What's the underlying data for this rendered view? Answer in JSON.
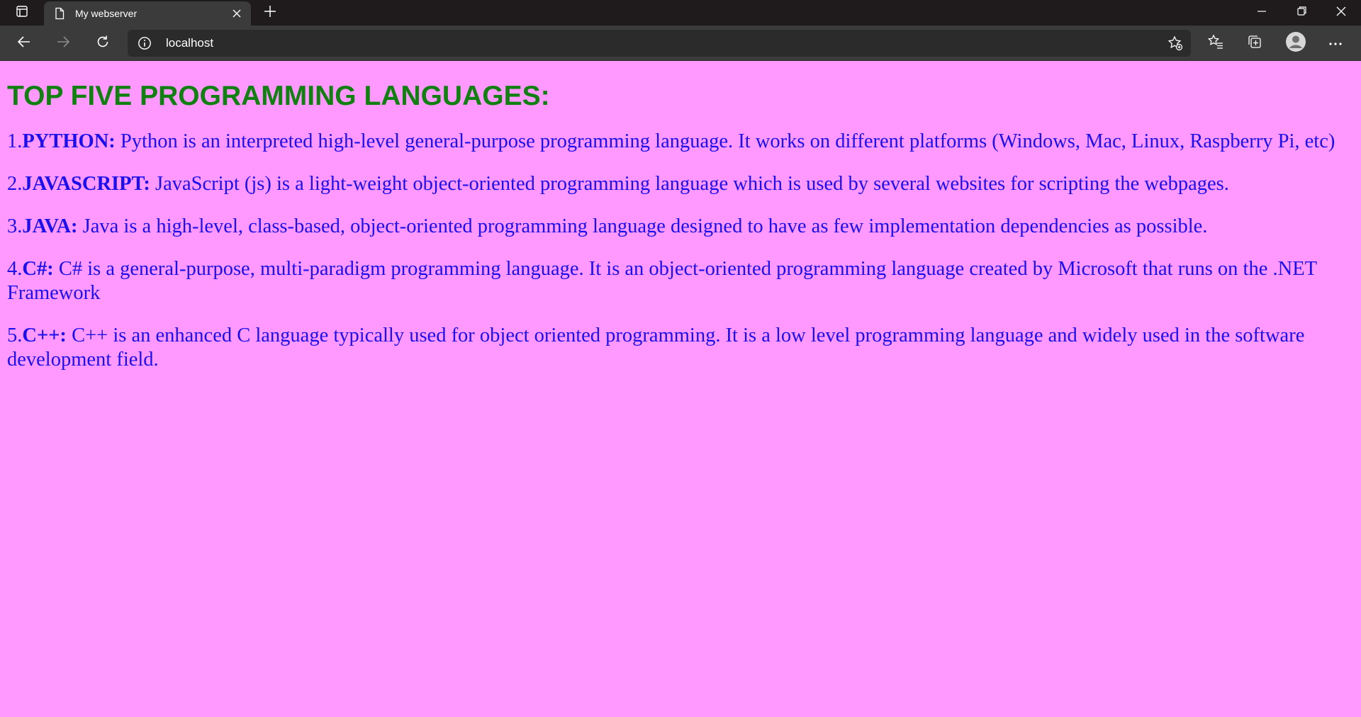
{
  "browser": {
    "tab_title": "My webserver",
    "url": "localhost",
    "icons": {
      "tab_actions": "tab-actions-icon",
      "page": "page-icon",
      "close": "close-icon",
      "new_tab": "plus-icon",
      "back": "back-arrow-icon",
      "forward": "forward-arrow-icon",
      "refresh": "refresh-icon",
      "info": "info-icon",
      "add_favorite": "star-add-icon",
      "favorites": "favorites-icon",
      "collections": "collections-icon",
      "profile": "avatar-icon",
      "more": "more-icon",
      "minimize": "minimize-icon",
      "restore": "restore-icon",
      "window_close": "window-close-icon"
    }
  },
  "page": {
    "heading": "TOP FIVE PROGRAMMING LANGUAGES:",
    "languages": [
      {
        "number": "1.",
        "name": "PYTHON:",
        "text": " Python is an interpreted high-level general-purpose programming language. It works on different platforms (Windows, Mac, Linux, Raspberry Pi, etc)"
      },
      {
        "number": "2.",
        "name": "JAVASCRIPT:",
        "text": " JavaScript (js) is a light-weight object-oriented programming language which is used by several websites for scripting the webpages."
      },
      {
        "number": "3.",
        "name": "JAVA:",
        "text": " Java is a high-level, class-based, object-oriented programming language designed to have as few implementation dependencies as possible."
      },
      {
        "number": "4.",
        "name": "C#:",
        "text": " C# is a general-purpose, multi-paradigm programming language. It is an object-oriented programming language created by Microsoft that runs on the .NET Framework"
      },
      {
        "number": "5.",
        "name": "C++:",
        "text": " C++ is an enhanced C language typically used for object oriented programming. It is a low level programming language and widely used in the software development field."
      }
    ]
  },
  "colors": {
    "page_background": "#ff99ff",
    "heading": "#108010",
    "body_text": "#1a10ee",
    "titlebar": "#1f1b1c",
    "toolbar": "#3b3b3b"
  }
}
